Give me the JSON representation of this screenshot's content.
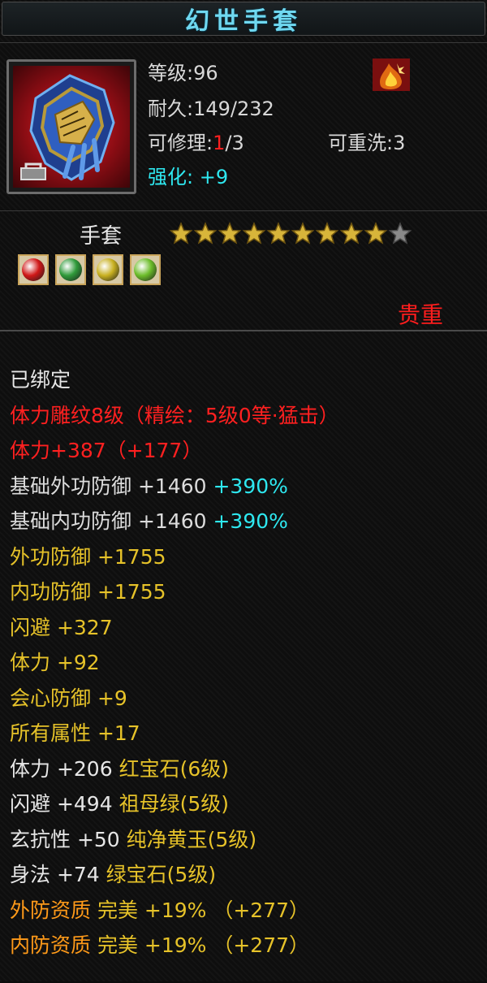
{
  "title": "幻世手套",
  "item": {
    "icon": "gauntlet-icon",
    "bound_icon": "lock-icon",
    "class_icon": "flame-class-icon",
    "level_label": "等级:",
    "level_value": "96",
    "durability_label": "耐久:",
    "durability_value": "149/232",
    "repair_label": "可修理:",
    "repair_current": "1",
    "repair_max": "/3",
    "rewash_label": "可重洗:",
    "rewash_value": "3",
    "enhance_label": "强化:",
    "enhance_value": "+9"
  },
  "type_label": "手套",
  "stars": {
    "filled": 9,
    "total": 10
  },
  "gems": [
    {
      "icon": "ruby-gem-icon",
      "color": "#d01818"
    },
    {
      "icon": "emerald-gem-icon",
      "color": "#2f9a3a"
    },
    {
      "icon": "yellow-jade-gem-icon",
      "color": "#c8b020"
    },
    {
      "icon": "green-sapphire-gem-icon",
      "color": "#6cbd2a"
    }
  ],
  "quality": "贵重",
  "attributes": [
    {
      "segments": [
        {
          "text": "已绑定",
          "color": "white"
        }
      ]
    },
    {
      "segments": [
        {
          "text": "体力雕纹8级（精绘：5级0等·猛击）",
          "color": "red"
        }
      ]
    },
    {
      "segments": [
        {
          "text": "体力+387（+177）",
          "color": "red"
        }
      ]
    },
    {
      "segments": [
        {
          "text": "基础外功防御 +1460 ",
          "color": "gray"
        },
        {
          "text": "+390%",
          "color": "cyan"
        }
      ]
    },
    {
      "segments": [
        {
          "text": "基础内功防御 +1460 ",
          "color": "gray"
        },
        {
          "text": "+390%",
          "color": "cyan"
        }
      ]
    },
    {
      "segments": [
        {
          "text": "外功防御 +1755",
          "color": "yellow"
        }
      ]
    },
    {
      "segments": [
        {
          "text": "内功防御 +1755",
          "color": "yellow"
        }
      ]
    },
    {
      "segments": [
        {
          "text": "闪避 +327",
          "color": "yellow"
        }
      ]
    },
    {
      "segments": [
        {
          "text": "体力 +92",
          "color": "yellow"
        }
      ]
    },
    {
      "segments": [
        {
          "text": "会心防御 +9",
          "color": "yellow"
        }
      ]
    },
    {
      "segments": [
        {
          "text": "所有属性 +17",
          "color": "yellow"
        }
      ]
    },
    {
      "segments": [
        {
          "text": "体力 +206 ",
          "color": "white"
        },
        {
          "text": "红宝石(6级)",
          "color": "yellow"
        }
      ]
    },
    {
      "segments": [
        {
          "text": "闪避 +494 ",
          "color": "white"
        },
        {
          "text": "祖母绿(5级)",
          "color": "yellow"
        }
      ]
    },
    {
      "segments": [
        {
          "text": "玄抗性 +50 ",
          "color": "white"
        },
        {
          "text": "纯净黄玉(5级)",
          "color": "yellow"
        }
      ]
    },
    {
      "segments": [
        {
          "text": "身法 +74 ",
          "color": "white"
        },
        {
          "text": "绿宝石(5级)",
          "color": "yellow"
        }
      ]
    },
    {
      "segments": [
        {
          "text": "外防资质  ",
          "color": "orange"
        },
        {
          "text": "完美 +19% （+277）",
          "color": "yellow"
        }
      ]
    },
    {
      "segments": [
        {
          "text": "内防资质  ",
          "color": "orange"
        },
        {
          "text": "完美 +19% （+277）",
          "color": "yellow"
        }
      ]
    }
  ]
}
